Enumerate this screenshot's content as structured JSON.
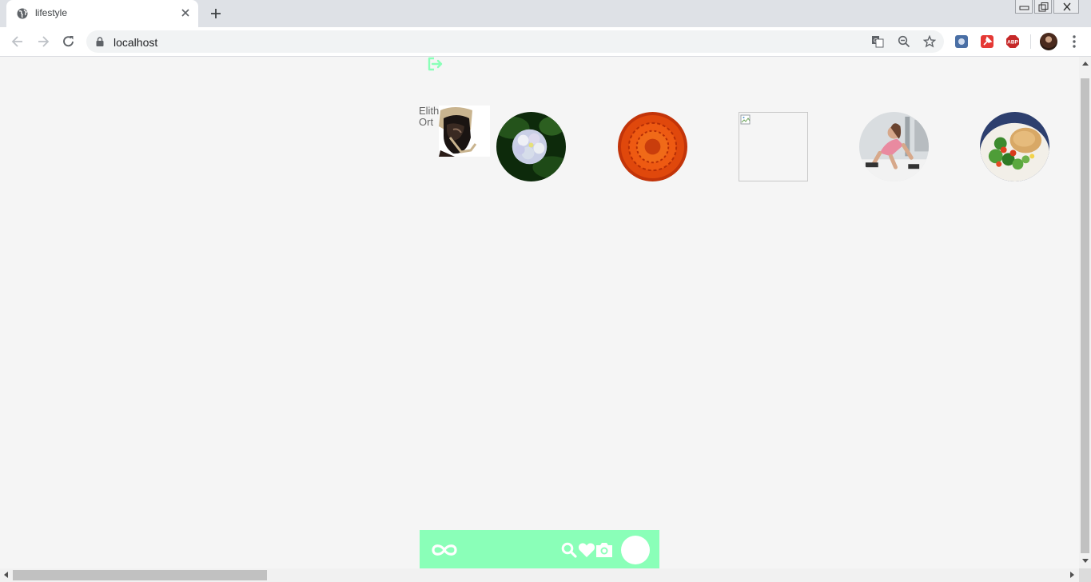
{
  "browser": {
    "tab": {
      "title": "lifestyle",
      "favicon": "globe-icon"
    },
    "address": {
      "url": "localhost"
    },
    "omnibox_icons": [
      "translate-icon",
      "zoom-out-icon",
      "bookmark-star-icon"
    ],
    "extensions": [
      {
        "name": "puzzle-extension-icon",
        "color": "#4a6fa5"
      },
      {
        "name": "pin-extension-icon",
        "color": "#e53935"
      },
      {
        "name": "adblock-extension-icon",
        "color": "#c62828",
        "label": "ABP"
      }
    ]
  },
  "page": {
    "header": {
      "logout_icon": "logout-icon",
      "accent": "#8affb8"
    },
    "user": {
      "first_name": "Elith",
      "last_name": "Ort"
    },
    "stories": [
      {
        "name": "hydrangea-story",
        "kind": "image"
      },
      {
        "name": "orange-flower-story",
        "kind": "image"
      },
      {
        "name": "broken-image-story",
        "kind": "broken"
      },
      {
        "name": "fitness-woman-story",
        "kind": "image"
      },
      {
        "name": "salad-story",
        "kind": "image"
      }
    ],
    "bottom_nav": {
      "background": "#8affb8",
      "items": [
        "infinity-logo-icon",
        "search-icon",
        "heart-icon",
        "camera-icon",
        "profile-avatar"
      ]
    }
  }
}
